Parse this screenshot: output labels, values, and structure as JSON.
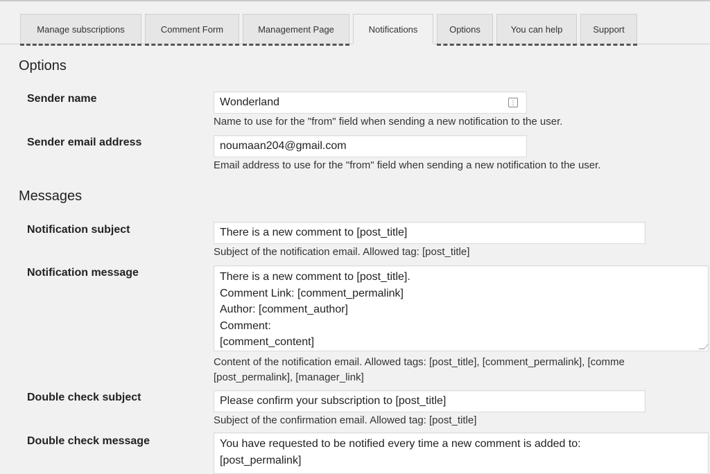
{
  "tabs": [
    {
      "label": "Manage subscriptions"
    },
    {
      "label": "Comment Form"
    },
    {
      "label": "Management Page"
    },
    {
      "label": "Notifications",
      "active": true
    },
    {
      "label": "Options"
    },
    {
      "label": "You can help"
    },
    {
      "label": "Support"
    }
  ],
  "options_section": {
    "heading": "Options",
    "sender_name": {
      "label": "Sender name",
      "value": "Wonderland",
      "description": "Name to use for the \"from\" field when sending a new notification to the user."
    },
    "sender_email": {
      "label": "Sender email address",
      "value": "noumaan204@gmail.com",
      "description": "Email address to use for the \"from\" field when sending a new notification to the user."
    }
  },
  "messages_section": {
    "heading": "Messages",
    "notification_subject": {
      "label": "Notification subject",
      "value": "There is a new comment to [post_title]",
      "description": "Subject of the notification email. Allowed tag: [post_title]"
    },
    "notification_message": {
      "label": "Notification message",
      "lines": [
        "There is a new comment to [post_title].",
        "Comment Link: [comment_permalink]",
        "Author: [comment_author]",
        "Comment:",
        "[comment_content]"
      ],
      "description_line1": "Content of the notification email. Allowed tags: [post_title], [comment_permalink], [comme",
      "description_line2": "[post_permalink], [manager_link]"
    },
    "double_check_subject": {
      "label": "Double check subject",
      "value": "Please confirm your subscription to [post_title]",
      "description": "Subject of the confirmation email. Allowed tag: [post_title]"
    },
    "double_check_message": {
      "label": "Double check message",
      "lines": [
        "You have requested to be notified every time a new comment is added to:",
        "[post_permalink]"
      ]
    }
  },
  "colors": {
    "background": "#f1f1f1",
    "tab_inactive": "#e6e6e6",
    "input_bg": "#ffffff"
  }
}
